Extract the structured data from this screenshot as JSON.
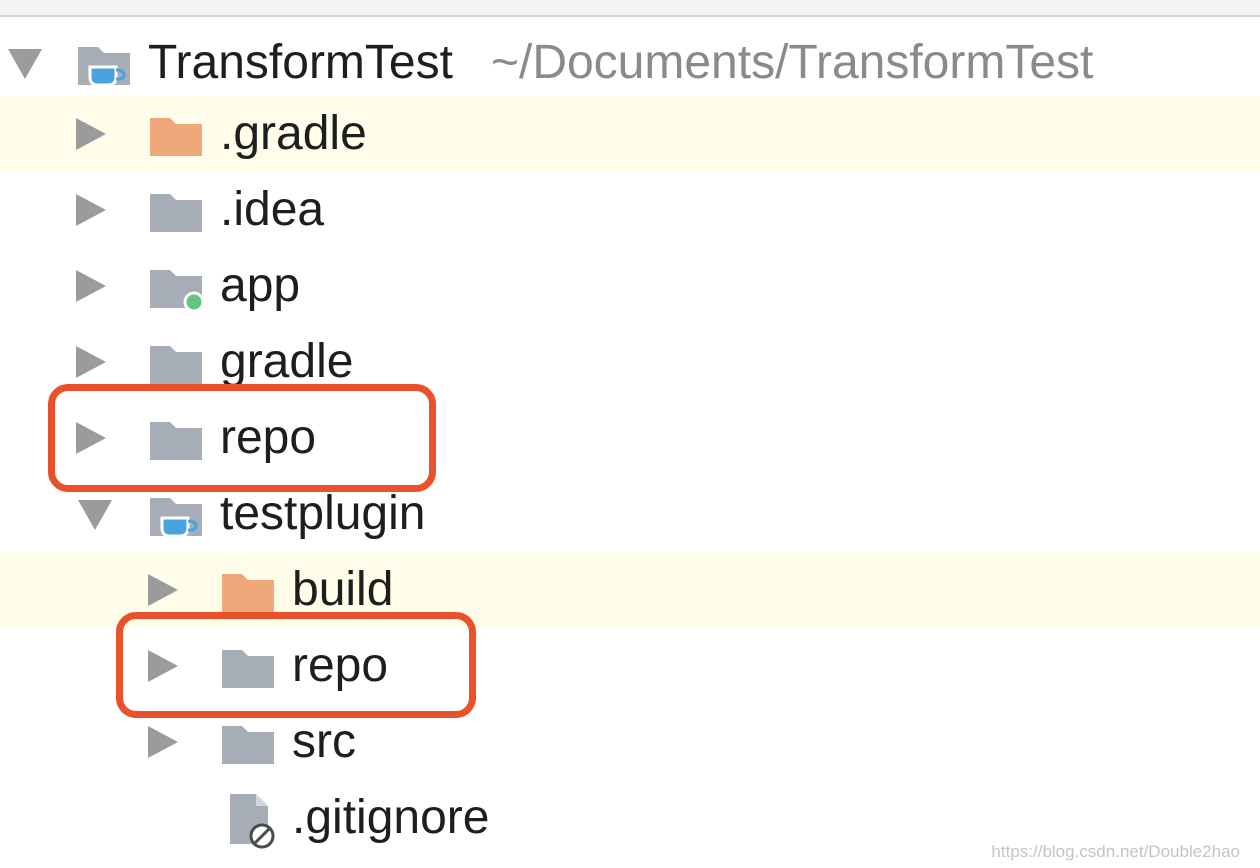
{
  "project": {
    "name": "TransformTest",
    "path": "~/Documents/TransformTest"
  },
  "items": {
    "gradle_hidden": ".gradle",
    "idea": ".idea",
    "app": "app",
    "gradle": "gradle",
    "repo_root": "repo",
    "testplugin": "testplugin",
    "build": "build",
    "repo_plugin": "repo",
    "src": "src",
    "gitignore": ".gitignore"
  },
  "colors": {
    "folder_gray": "#a7adb6",
    "folder_excluded": "#eea77b",
    "module_badge": "#4aa3df",
    "source_dot": "#62c77c",
    "highlight_row": "#fdfde9",
    "callout_red": "#e8512a"
  },
  "watermark": "https://blog.csdn.net/Double2hao"
}
